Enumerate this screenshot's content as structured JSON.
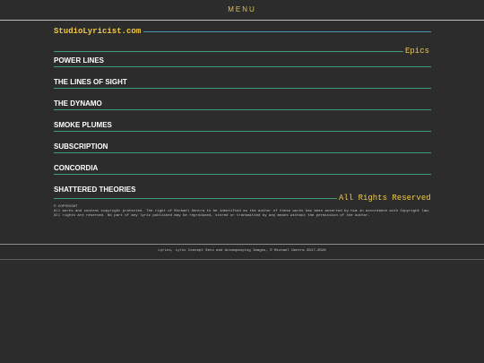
{
  "header": {
    "menu_label": "MENU"
  },
  "site": {
    "title": "StudioLyricist.com"
  },
  "section": {
    "label": "Epics"
  },
  "items": [
    {
      "label": "POWER LINES"
    },
    {
      "label": "THE LINES OF SIGHT"
    },
    {
      "label": "THE DYNAMO"
    },
    {
      "label": "SMOKE PLUMES"
    },
    {
      "label": "SUBSCRIPTION"
    },
    {
      "label": "CONCORDIA"
    },
    {
      "label": "SHATTERED THEORIES"
    }
  ],
  "rights": {
    "label": "All Rights Reserved",
    "copyright_heading": "© COPYRIGHT",
    "copyright_text": "All works and content copyright protected. The right of Michael Gentra to be identified as the author of these works has been asserted by him in accordance with Copyright law. All rights are reserved. No part of any lyric published may be reproduced, stored or transmitted by any means without the permission of the author."
  },
  "footer": {
    "text": "Lyrics, Lyric Concept Sets and Accompanying Images, © Michael Gentra 2017-2026"
  },
  "colors": {
    "background": "#2c2c2c",
    "accent_gold": "#f0c846",
    "rule_green": "#3f9f7c",
    "rule_blue": "#4f93b0"
  }
}
